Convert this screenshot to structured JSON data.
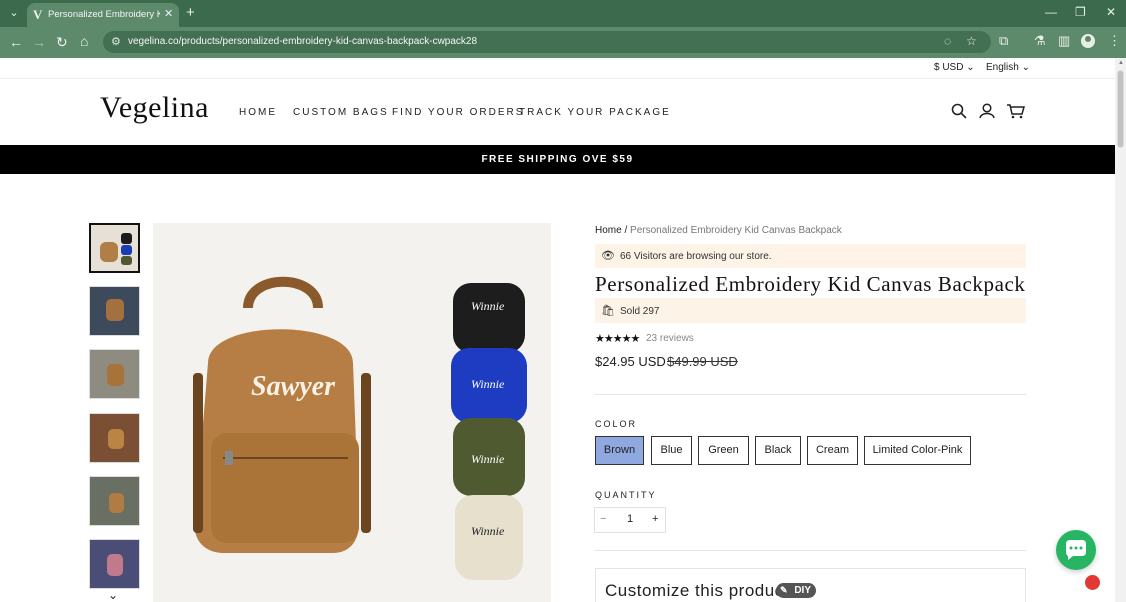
{
  "browser": {
    "tab_title": "Personalized Embroidery Kid Ca",
    "tab_favicon": "V",
    "url": "vegelina.co/products/personalized-embroidery-kid-canvas-backpack-cwpack28"
  },
  "utility": {
    "currency": "$ USD",
    "language": "English"
  },
  "header": {
    "logo": "Vegelina",
    "nav": [
      "HOME",
      "CUSTOM BAGS",
      "FIND YOUR ORDERS",
      "TRACK YOUR PACKAGE"
    ]
  },
  "promo": "FREE SHIPPING OVE $59",
  "breadcrumb": {
    "home": "Home",
    "sep": "/",
    "current": "Personalized Embroidery Kid Canvas Backpack"
  },
  "visitors_text": "66 Visitors are browsing our store.",
  "product": {
    "title": "Personalized Embroidery Kid Canvas Backpack",
    "sold": "Sold 297",
    "stars": "★★★★★",
    "reviews": "23 reviews",
    "price": "$24.95 USD",
    "compare_price": "$49.99 USD",
    "hero_name": "Sawyer",
    "thumb_name": "Winnie"
  },
  "color": {
    "label": "COLOR",
    "options": [
      "Brown",
      "Blue",
      "Green",
      "Black",
      "Cream",
      "Limited Color-Pink"
    ],
    "selected": "Brown"
  },
  "quantity": {
    "label": "QUANTITY",
    "minus": "−",
    "value": "1",
    "plus": "+"
  },
  "customize": {
    "title": "Customize this product",
    "badge": "DIY"
  },
  "colors": {
    "chrome": "#5d8a6b",
    "tab_strip": "#3c6a4c",
    "selected_swatch": "#90a8e0",
    "banner": "#fdf3e6",
    "chat": "#27b564"
  }
}
